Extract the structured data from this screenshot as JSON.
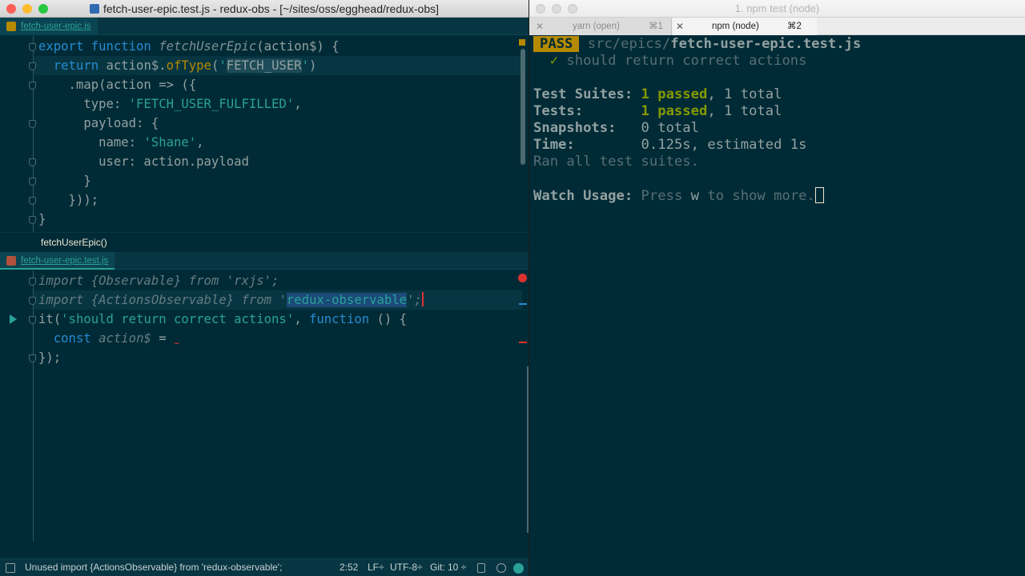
{
  "editor": {
    "window_title": "fetch-user-epic.test.js - redux-obs - [~/sites/oss/egghead/redux-obs]",
    "top_pane": {
      "tab_label": "fetch-user-epic.js",
      "lines": [
        {
          "parts": [
            [
              "kw",
              "export function "
            ],
            [
              "fn",
              "fetchUserEpic"
            ],
            [
              "",
              "(action$) {"
            ]
          ]
        },
        {
          "parts": [
            [
              "",
              "  "
            ],
            [
              "kw",
              "return "
            ],
            [
              "",
              "action$."
            ],
            [
              "meth",
              "ofType"
            ],
            [
              "",
              "("
            ],
            [
              "str",
              "'"
            ],
            [
              "hl",
              "FETCH_USER"
            ],
            [
              "str",
              "'"
            ],
            [
              "",
              ")"
            ]
          ]
        },
        {
          "parts": [
            [
              "",
              "    .map(action => ({"
            ]
          ]
        },
        {
          "parts": [
            [
              "",
              "      type: "
            ],
            [
              "str",
              "'FETCH_USER_FULFILLED'"
            ],
            [
              "",
              ","
            ]
          ]
        },
        {
          "parts": [
            [
              "",
              "      payload: {"
            ]
          ]
        },
        {
          "parts": [
            [
              "",
              "        name: "
            ],
            [
              "str",
              "'Shane'"
            ],
            [
              "",
              ","
            ]
          ]
        },
        {
          "parts": [
            [
              "",
              "        user: action.payload"
            ]
          ]
        },
        {
          "parts": [
            [
              "",
              "      }"
            ]
          ]
        },
        {
          "parts": [
            [
              "",
              "    }));"
            ]
          ]
        },
        {
          "parts": [
            [
              "",
              "}"
            ]
          ]
        }
      ]
    },
    "breadcrumb": "fetchUserEpic()",
    "bottom_pane": {
      "tab_label": "fetch-user-epic.test.js",
      "lines": [
        {
          "parts": [
            [
              "dim",
              "import {Observable} from 'rxjs';"
            ]
          ]
        },
        {
          "parts": [
            [
              "dim",
              "import {ActionsObservable} from "
            ],
            [
              "dim",
              "'"
            ],
            [
              "hl2",
              "redux-observable"
            ],
            [
              "dim",
              "';"
            ]
          ]
        },
        {
          "parts": [
            [
              "",
              "it("
            ],
            [
              "str",
              "'should return correct actions'"
            ],
            [
              "",
              ", "
            ],
            [
              "kw",
              "function "
            ],
            [
              "",
              "() {"
            ]
          ]
        },
        {
          "parts": [
            [
              "",
              "  "
            ],
            [
              "kw",
              "const "
            ],
            [
              "dim",
              "action$"
            ],
            [
              "",
              " = "
            ]
          ]
        },
        {
          "parts": [
            [
              "",
              "});"
            ]
          ]
        }
      ]
    },
    "status": {
      "message": "Unused  import {ActionsObservable} from 'redux-observable';",
      "position": "2:52",
      "line_ending": "LF÷",
      "encoding": "UTF-8÷",
      "git": "Git: 10 ÷"
    }
  },
  "terminal": {
    "window_title": "1. npm test (node)",
    "tabs": [
      {
        "label": "yarn (open)",
        "shortcut": "⌘1"
      },
      {
        "label": "npm (node)",
        "shortcut": "⌘2"
      }
    ],
    "pass_badge": "PASS",
    "test_path_dir": "src/epics/",
    "test_path_file": "fetch-user-epic.test.js",
    "check_mark": "✓",
    "test_name": "should return correct actions",
    "summary": {
      "suites_label": "Test Suites:",
      "suites_value": "1 passed",
      "suites_total": ", 1 total",
      "tests_label": "Tests:",
      "tests_value": "1 passed",
      "tests_total": ", 1 total",
      "snapshots_label": "Snapshots:",
      "snapshots_value": "0 total",
      "time_label": "Time:",
      "time_value": "0.125s, estimated 1s",
      "ran_all": "Ran all test suites."
    },
    "watch_label": "Watch Usage:",
    "watch_press": "Press ",
    "watch_key": "w",
    "watch_rest": " to show more."
  },
  "colors": {
    "background": "#002b36",
    "keyword": "#268bd2",
    "string": "#2aa198",
    "pass_badge": "#b58900",
    "error": "#dc322f"
  }
}
